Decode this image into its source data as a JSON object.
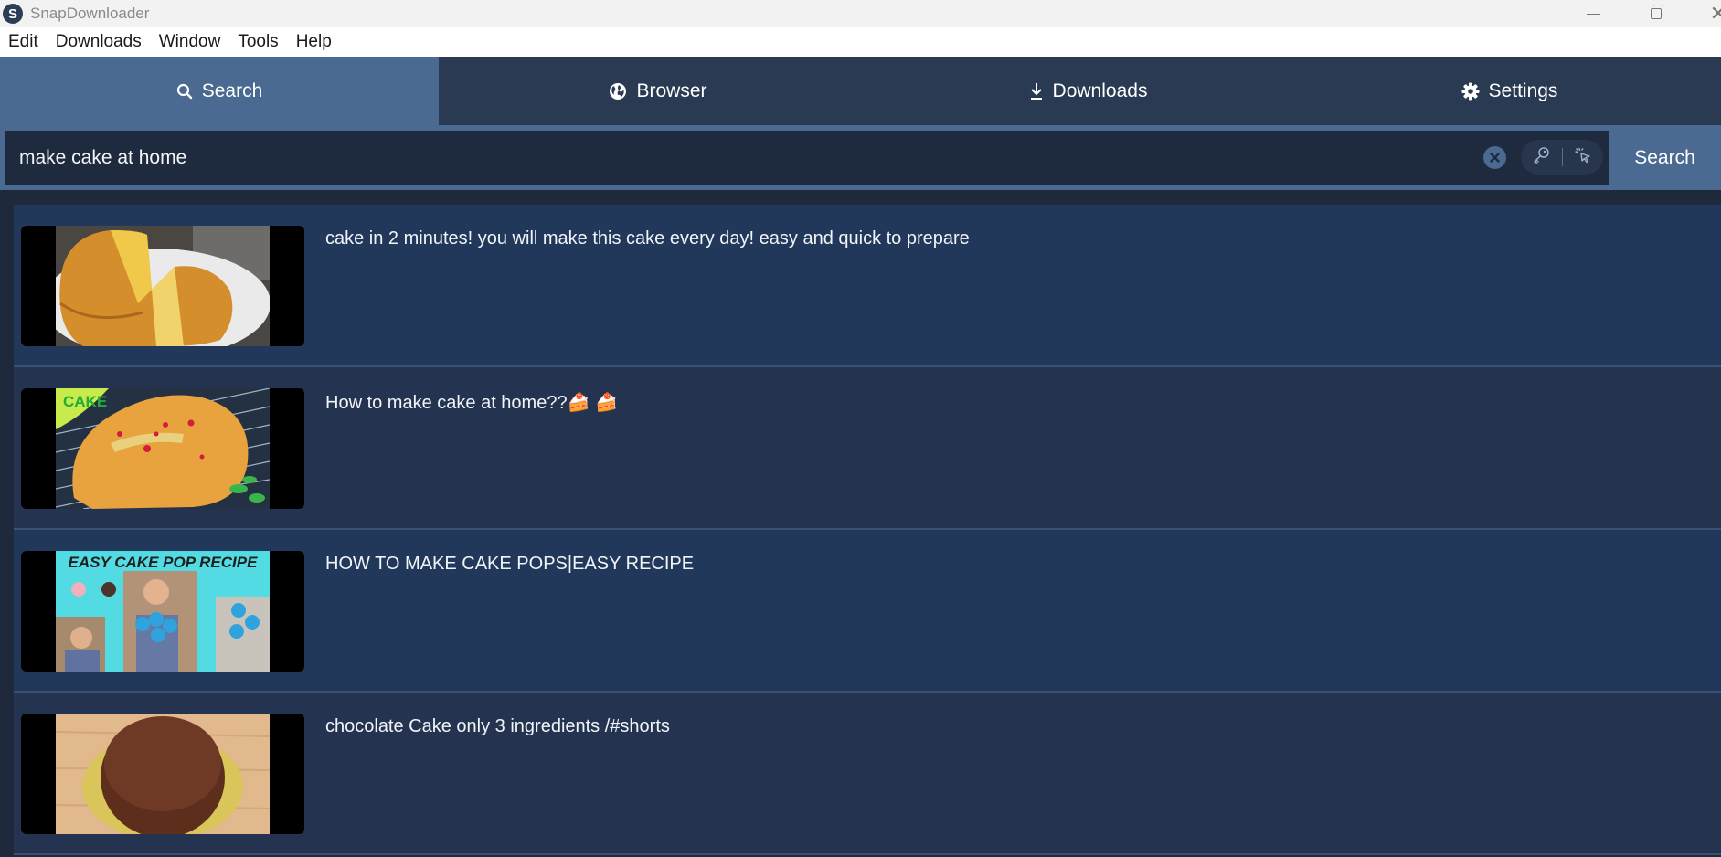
{
  "window": {
    "title": "SnapDownloader",
    "logo_letter": "S",
    "controls": [
      "minimize",
      "restore",
      "close"
    ]
  },
  "menu": [
    {
      "label": "Edit"
    },
    {
      "label": "Downloads"
    },
    {
      "label": "Window"
    },
    {
      "label": "Tools"
    },
    {
      "label": "Help"
    }
  ],
  "tabs": [
    {
      "label": "Search",
      "icon": "search-icon",
      "active": true
    },
    {
      "label": "Browser",
      "icon": "globe-icon",
      "active": false
    },
    {
      "label": "Downloads",
      "icon": "download-icon",
      "active": false
    },
    {
      "label": "Settings",
      "icon": "gear-icon",
      "active": false
    }
  ],
  "search": {
    "value": "make cake at home",
    "button_label": "Search",
    "icons": [
      "clear-icon",
      "key-icon",
      "pointer-click-icon"
    ]
  },
  "results": [
    {
      "title": "cake in 2 minutes! you will make this cake every day! easy and quick to prepare",
      "thumbnail": "sliced sponge cake on plate"
    },
    {
      "title": "How to make cake at home??🍰 🍰",
      "thumbnail": "cake on cooling rack with CAKE label"
    },
    {
      "title": "HOW TO MAKE CAKE POPS|EASY RECIPE",
      "thumbnail": "EASY CAKE POP RECIPE collage",
      "thumbnail_text": "EASY CAKE POP RECIPE"
    },
    {
      "title": "chocolate Cake only 3 ingredients /#shorts",
      "thumbnail": "chocolate cake on gold board"
    }
  ],
  "colors": {
    "accent": "#4a6a91",
    "tab_bar": "#293a52",
    "input_bg": "#1e2a3e",
    "list_bg_odd": "#22385a",
    "list_bg_even": "#243450"
  }
}
